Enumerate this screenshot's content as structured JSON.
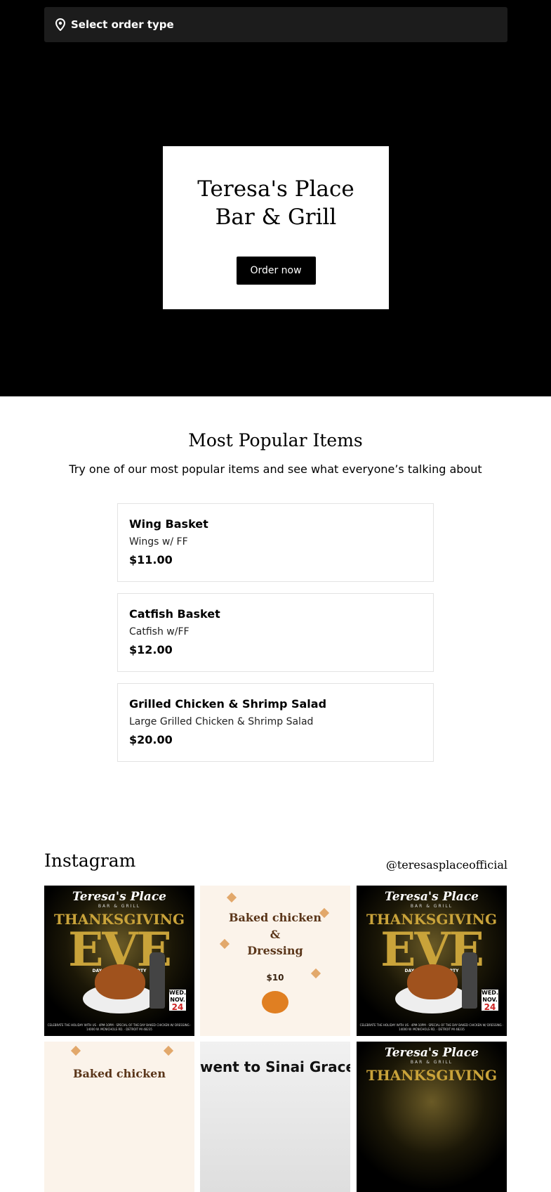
{
  "order_bar": {
    "label": "Select order type",
    "icon": "location-pin-icon"
  },
  "hero": {
    "title_line1": "Teresa's Place",
    "title_line2": "Bar & Grill",
    "order_button": "Order now"
  },
  "popular": {
    "heading": "Most Popular Items",
    "subheading": "Try one of our most popular items and see what everyone’s talking about",
    "items": [
      {
        "name": "Wing Basket",
        "description": "Wings w/ FF",
        "price": "$11.00"
      },
      {
        "name": "Catfish Basket",
        "description": "Catfish w/FF",
        "price": "$12.00"
      },
      {
        "name": "Grilled Chicken & Shrimp Salad",
        "description": "Large Grilled Chicken & Shrimp Salad",
        "price": "$20.00"
      }
    ]
  },
  "instagram": {
    "title": "Instagram",
    "handle": "@teresasplaceofficial",
    "posts": {
      "thanksgiving": {
        "brand": "Teresa's Place",
        "brand_sub": "BAR & GRILL",
        "headline1": "THANKSGIVING",
        "headline2": "EVE",
        "tagline": "DAY AND NIGHT PARTY",
        "date_day": "WED. NOV.",
        "date_num": "24",
        "footer": "CELEBRATE THE HOLIDAY WITH US · 4PM-10PM · SPECIAL OF THE DAY BAKED CHICKEN W/ DRESSING · 14000 W. MCNICHOLS RD. · DETROIT MI 48235"
      },
      "baked": {
        "line1": "Baked chicken",
        "line2": "&",
        "line3": "Dressing",
        "price": "$10"
      },
      "sinai": {
        "headline": "went to Sinai Grace"
      }
    }
  },
  "colors": {
    "hero_bg": "#000000",
    "accent_gold": "#c9a33a",
    "order_bar_bg": "#1c1c1c"
  }
}
